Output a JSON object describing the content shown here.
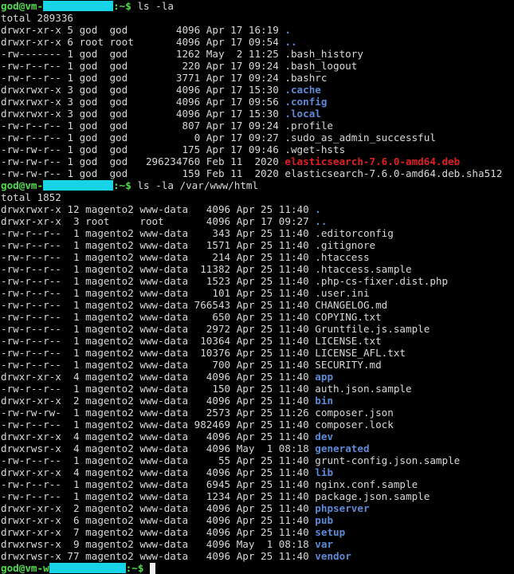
{
  "terminal": {
    "user": "god",
    "host_prefix": "vm-",
    "prompt_suffix": ":~$ ",
    "colors": {
      "background": "#000000",
      "text": "#d8d8d8",
      "prompt": "#4fe04a",
      "directory": "#5b8bd6",
      "deb_file": "#e02020",
      "redaction": "#17d3e6"
    },
    "blocks": [
      {
        "command": "ls -la",
        "host_suffix": "",
        "total": "total 289336",
        "entries": [
          {
            "text": "drwxr-xr-x 5 god  god        4096 Apr 17 16:19 ",
            "name": ".",
            "kind": "dir"
          },
          {
            "text": "drwxr-xr-x 6 root root       4096 Apr 17 09:54 ",
            "name": "..",
            "kind": "dir"
          },
          {
            "text": "-rw------- 1 god  god        1262 May  2 11:25 ",
            "name": ".bash_history",
            "kind": "plain"
          },
          {
            "text": "-rw-r--r-- 1 god  god         220 Apr 17 09:24 ",
            "name": ".bash_logout",
            "kind": "plain"
          },
          {
            "text": "-rw-r--r-- 1 god  god        3771 Apr 17 09:24 ",
            "name": ".bashrc",
            "kind": "plain"
          },
          {
            "text": "drwxrwxr-x 3 god  god        4096 Apr 17 15:30 ",
            "name": ".cache",
            "kind": "dir"
          },
          {
            "text": "drwxrwxr-x 3 god  god        4096 Apr 17 09:56 ",
            "name": ".config",
            "kind": "dir"
          },
          {
            "text": "drwxrwxr-x 3 god  god        4096 Apr 17 15:30 ",
            "name": ".local",
            "kind": "dir"
          },
          {
            "text": "-rw-r--r-- 1 god  god         807 Apr 17 09:24 ",
            "name": ".profile",
            "kind": "plain"
          },
          {
            "text": "-rw-r--r-- 1 god  god           0 Apr 17 09:27 ",
            "name": ".sudo_as_admin_successful",
            "kind": "plain"
          },
          {
            "text": "-rw-rw-r-- 1 god  god         175 Apr 17 09:46 ",
            "name": ".wget-hsts",
            "kind": "plain"
          },
          {
            "text": "-rw-rw-r-- 1 god  god   296234760 Feb 11  2020 ",
            "name": "elasticsearch-7.6.0-amd64.deb",
            "kind": "exec"
          },
          {
            "text": "-rw-rw-r-- 1 god  god         159 Feb 11  2020 ",
            "name": "elasticsearch-7.6.0-amd64.deb.sha512",
            "kind": "plain"
          }
        ]
      },
      {
        "command": "ls -la /var/www/html",
        "host_suffix": "",
        "total": "total 1852",
        "entries": [
          {
            "text": "drwxrwxr-x 12 magento2 www-data   4096 Apr 25 11:40 ",
            "name": ".",
            "kind": "dir"
          },
          {
            "text": "drwxr-xr-x  3 root     root       4096 Apr 17 09:27 ",
            "name": "..",
            "kind": "dir"
          },
          {
            "text": "-rw-r--r--  1 magento2 www-data    343 Apr 25 11:40 ",
            "name": ".editorconfig",
            "kind": "plain"
          },
          {
            "text": "-rw-r--r--  1 magento2 www-data   1571 Apr 25 11:40 ",
            "name": ".gitignore",
            "kind": "plain"
          },
          {
            "text": "-rw-r--r--  1 magento2 www-data    214 Apr 25 11:40 ",
            "name": ".htaccess",
            "kind": "plain"
          },
          {
            "text": "-rw-r--r--  1 magento2 www-data  11382 Apr 25 11:40 ",
            "name": ".htaccess.sample",
            "kind": "plain"
          },
          {
            "text": "-rw-r--r--  1 magento2 www-data   1523 Apr 25 11:40 ",
            "name": ".php-cs-fixer.dist.php",
            "kind": "plain"
          },
          {
            "text": "-rw-r--r--  1 magento2 www-data    101 Apr 25 11:40 ",
            "name": ".user.ini",
            "kind": "plain"
          },
          {
            "text": "-rw-r--r--  1 magento2 www-data 766543 Apr 25 11:40 ",
            "name": "CHANGELOG.md",
            "kind": "plain"
          },
          {
            "text": "-rw-r--r--  1 magento2 www-data    650 Apr 25 11:40 ",
            "name": "COPYING.txt",
            "kind": "plain"
          },
          {
            "text": "-rw-r--r--  1 magento2 www-data   2972 Apr 25 11:40 ",
            "name": "Gruntfile.js.sample",
            "kind": "plain"
          },
          {
            "text": "-rw-r--r--  1 magento2 www-data  10364 Apr 25 11:40 ",
            "name": "LICENSE.txt",
            "kind": "plain"
          },
          {
            "text": "-rw-r--r--  1 magento2 www-data  10376 Apr 25 11:40 ",
            "name": "LICENSE_AFL.txt",
            "kind": "plain"
          },
          {
            "text": "-rw-r--r--  1 magento2 www-data    700 Apr 25 11:40 ",
            "name": "SECURITY.md",
            "kind": "plain"
          },
          {
            "text": "drwxr-xr-x  4 magento2 www-data   4096 Apr 25 11:40 ",
            "name": "app",
            "kind": "dir"
          },
          {
            "text": "-rw-r--r--  1 magento2 www-data    150 Apr 25 11:40 ",
            "name": "auth.json.sample",
            "kind": "plain"
          },
          {
            "text": "drwxr-xr-x  2 magento2 www-data   4096 Apr 25 11:40 ",
            "name": "bin",
            "kind": "dir"
          },
          {
            "text": "-rw-rw-rw-  1 magento2 www-data   2573 Apr 25 11:26 ",
            "name": "composer.json",
            "kind": "plain"
          },
          {
            "text": "-rw-r--r--  1 magento2 www-data 982469 Apr 25 11:40 ",
            "name": "composer.lock",
            "kind": "plain"
          },
          {
            "text": "drwxr-xr-x  4 magento2 www-data   4096 Apr 25 11:40 ",
            "name": "dev",
            "kind": "dir"
          },
          {
            "text": "drwxrwsr-x  4 magento2 www-data   4096 May  1 08:18 ",
            "name": "generated",
            "kind": "dir"
          },
          {
            "text": "-rw-r--r--  1 magento2 www-data     55 Apr 25 11:40 ",
            "name": "grunt-config.json.sample",
            "kind": "plain"
          },
          {
            "text": "drwxr-xr-x  4 magento2 www-data   4096 Apr 25 11:40 ",
            "name": "lib",
            "kind": "dir"
          },
          {
            "text": "-rw-r--r--  1 magento2 www-data   6945 Apr 25 11:40 ",
            "name": "nginx.conf.sample",
            "kind": "plain"
          },
          {
            "text": "-rw-r--r--  1 magento2 www-data   1234 Apr 25 11:40 ",
            "name": "package.json.sample",
            "kind": "plain"
          },
          {
            "text": "drwxr-xr-x  2 magento2 www-data   4096 Apr 25 11:40 ",
            "name": "phpserver",
            "kind": "dir"
          },
          {
            "text": "drwxr-xr-x  6 magento2 www-data   4096 Apr 25 11:40 ",
            "name": "pub",
            "kind": "dir"
          },
          {
            "text": "drwxr-xr-x  7 magento2 www-data   4096 Apr 25 11:40 ",
            "name": "setup",
            "kind": "dir"
          },
          {
            "text": "drwxrwsr-x  9 magento2 www-data   4096 May  1 08:18 ",
            "name": "var",
            "kind": "dir"
          },
          {
            "text": "drwxrwsr-x 77 magento2 www-data   4096 Apr 25 11:40 ",
            "name": "vendor",
            "kind": "dir"
          }
        ]
      }
    ],
    "final_prompt": {
      "host_prefix": "vm-w",
      "command": ""
    }
  }
}
